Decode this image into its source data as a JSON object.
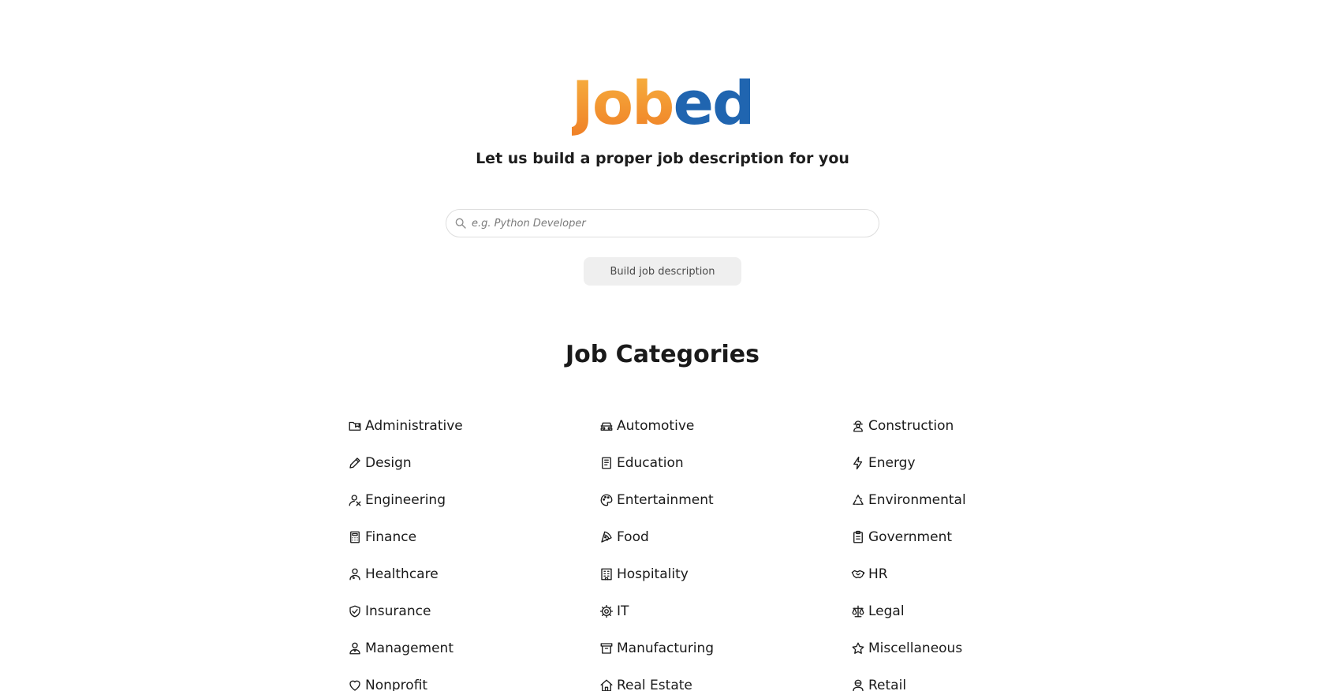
{
  "logo": {
    "part_a": "Job",
    "part_b": "ed",
    "colors": {
      "orange": "#f0932d",
      "blue": "#2065b0"
    }
  },
  "tagline": "Let us build a proper job description for you",
  "search": {
    "placeholder": "e.g. Python Developer",
    "value": "",
    "icon": "search-icon"
  },
  "build_button_label": "Build job description",
  "categories_title": "Job Categories",
  "categories": [
    {
      "label": "Administrative",
      "icon": "folder-icon"
    },
    {
      "label": "Automotive",
      "icon": "car-icon"
    },
    {
      "label": "Construction",
      "icon": "worker-icon"
    },
    {
      "label": "Design",
      "icon": "pencil-icon"
    },
    {
      "label": "Education",
      "icon": "book-icon"
    },
    {
      "label": "Energy",
      "icon": "bolt-icon"
    },
    {
      "label": "Engineering",
      "icon": "engineer-icon"
    },
    {
      "label": "Entertainment",
      "icon": "palette-icon"
    },
    {
      "label": "Environmental",
      "icon": "recycle-icon"
    },
    {
      "label": "Finance",
      "icon": "calculator-icon"
    },
    {
      "label": "Food",
      "icon": "pizza-icon"
    },
    {
      "label": "Government",
      "icon": "clipboard-icon"
    },
    {
      "label": "Healthcare",
      "icon": "doctor-icon"
    },
    {
      "label": "Hospitality",
      "icon": "hotel-icon"
    },
    {
      "label": "HR",
      "icon": "handshake-icon"
    },
    {
      "label": "Insurance",
      "icon": "shield-icon"
    },
    {
      "label": "IT",
      "icon": "gear-icon"
    },
    {
      "label": "Legal",
      "icon": "scale-icon"
    },
    {
      "label": "Management",
      "icon": "manager-icon"
    },
    {
      "label": "Manufacturing",
      "icon": "archive-icon"
    },
    {
      "label": "Miscellaneous",
      "icon": "star-icon"
    },
    {
      "label": "Nonprofit",
      "icon": "heart-icon"
    },
    {
      "label": "Real Estate",
      "icon": "house-icon"
    },
    {
      "label": "Retail",
      "icon": "cashier-icon"
    }
  ]
}
